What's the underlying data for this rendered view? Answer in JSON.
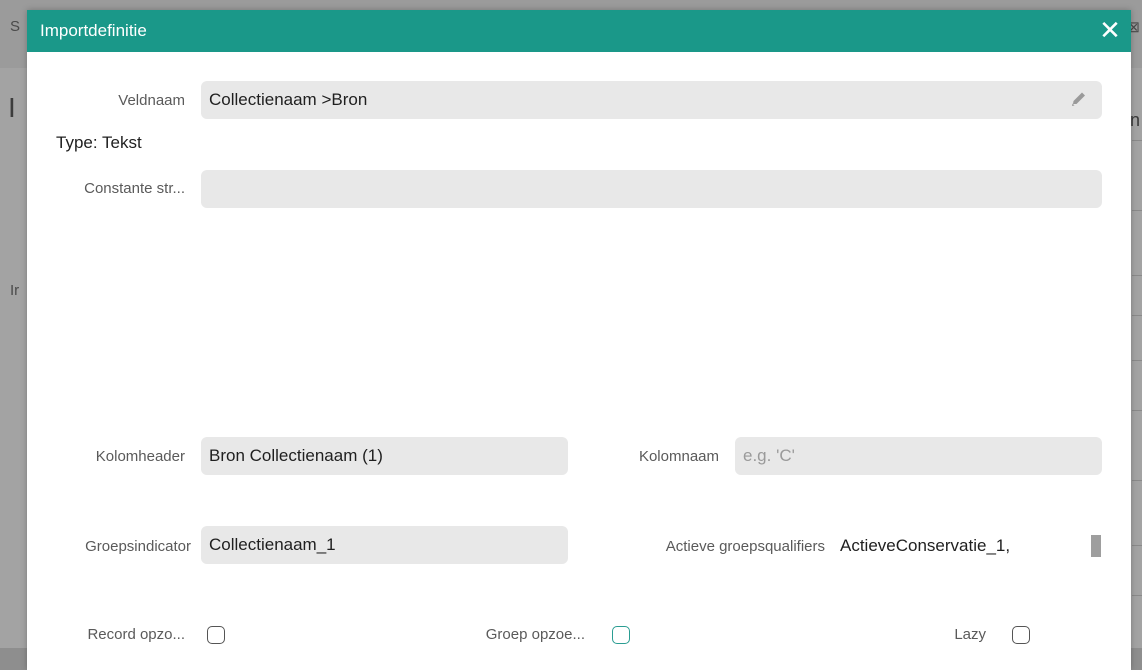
{
  "background": {
    "left_top": "S",
    "heading": "I",
    "left_mid": "Ir",
    "right_top": "⊠",
    "right_h": "n"
  },
  "modal": {
    "title": "Importdefinitie",
    "close_label": "✕",
    "accent_color": "#1a9889"
  },
  "fields": {
    "veldnaam_label": "Veldnaam",
    "veldnaam_value": "Collectienaam >Bron",
    "type_info": "Type: Tekst",
    "constante_label": "Constante str...",
    "constante_value": "",
    "kolomheader_label": "Kolomheader",
    "kolomheader_value": "Bron Collectienaam (1)",
    "kolomnaam_label": "Kolomnaam",
    "kolomnaam_placeholder": "e.g. 'C'",
    "groepsindicator_label": "Groepsindicator",
    "groepsindicator_value": "Collectienaam_1",
    "actieve_label": "Actieve groepsqualifiers",
    "actieve_value": "ActieveConservatie_1,"
  },
  "checkboxes": {
    "record_label": "Record opzo...",
    "record_checked": false,
    "groep_label": "Groep opzoe...",
    "groep_checked": false,
    "lazy_label": "Lazy",
    "lazy_checked": false
  }
}
